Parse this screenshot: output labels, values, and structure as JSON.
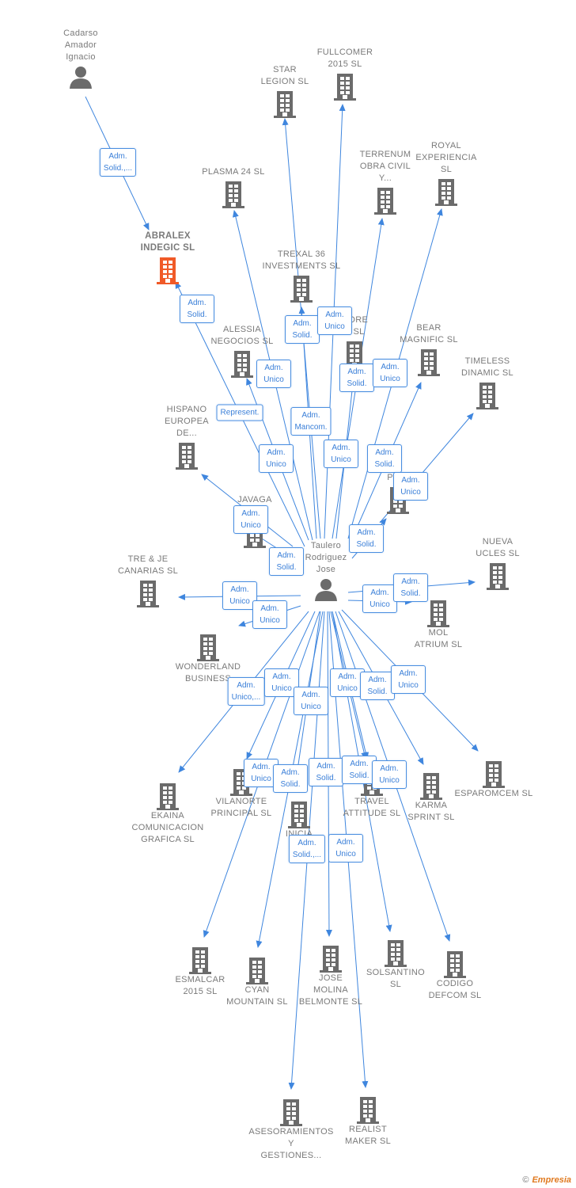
{
  "colors": {
    "edge": "#3f86de",
    "building": "#6b6b6b",
    "highlight": "#f05a28",
    "label": "#7a7a7a"
  },
  "center": {
    "name": "Taulero\nRodriguez\nJose",
    "icon": "person-icon"
  },
  "nodes": [
    {
      "name": "Cadarso\nAmador\nIgnacio",
      "icon": "person-icon"
    },
    {
      "name": "ABRALEX\nINDEGIC  SL",
      "icon": "building-icon",
      "highlight": true
    },
    {
      "name": "STAR\nLEGION  SL",
      "icon": "building-icon"
    },
    {
      "name": "FULLCOMER\n2015  SL",
      "icon": "building-icon"
    },
    {
      "name": "PLASMA 24 SL",
      "icon": "building-icon"
    },
    {
      "name": "TERRENUM\nOBRA CIVIL\nY...",
      "icon": "building-icon"
    },
    {
      "name": "ROYAL\nEXPERIENCIA\nSL",
      "icon": "building-icon"
    },
    {
      "name": "TREXAL 36\nINVESTMENTS SL",
      "icon": "building-icon"
    },
    {
      "name": "ALESSIA\nNEGOCIOS  SL",
      "icon": "building-icon"
    },
    {
      "name": "MORE\nS  SL",
      "icon": "building-icon"
    },
    {
      "name": "BEAR\nMAGNIFIC  SL",
      "icon": "building-icon"
    },
    {
      "name": "TIMELESS\nDINAMIC  SL",
      "icon": "building-icon"
    },
    {
      "name": "HISPANO\nEUROPEA\nDE...",
      "icon": "building-icon"
    },
    {
      "name": "E\nPIGE",
      "icon": "building-icon"
    },
    {
      "name": "JAVAGA\nM     SL",
      "icon": "building-icon"
    },
    {
      "name": "TRE & JE\nCANARIAS  SL",
      "icon": "building-icon"
    },
    {
      "name": "NUEVA\nUCLES  SL",
      "icon": "building-icon"
    },
    {
      "name": "MOL\nATRIUM  SL",
      "icon": "building-icon"
    },
    {
      "name": "WONDERLAND\nBUSINESS",
      "icon": "building-icon"
    },
    {
      "name": "EKAINA\nCOMUNICACION\nGRAFICA  SL",
      "icon": "building-icon"
    },
    {
      "name": "VILANORTE\nPRINCIPAL  SL",
      "icon": "building-icon"
    },
    {
      "name": "INICIA\nSP",
      "icon": "building-icon"
    },
    {
      "name": "TRAVEL\nATTITUDE  SL",
      "icon": "building-icon"
    },
    {
      "name": "KARMA\nSPRINT  SL",
      "icon": "building-icon"
    },
    {
      "name": "ESPAROMCEM SL",
      "icon": "building-icon"
    },
    {
      "name": "ESMALCAR\n2015  SL",
      "icon": "building-icon"
    },
    {
      "name": "CYAN\nMOUNTAIN  SL",
      "icon": "building-icon"
    },
    {
      "name": "JOSE\nMOLINA\nBELMONTE  SL",
      "icon": "building-icon"
    },
    {
      "name": "SOLSANTINO\nSL",
      "icon": "building-icon"
    },
    {
      "name": "CODIGO\nDEFCOM  SL",
      "icon": "building-icon"
    },
    {
      "name": "ASESORAMIENTOS\nY\nGESTIONES...",
      "icon": "building-icon"
    },
    {
      "name": "REALIST\nMAKER  SL",
      "icon": "building-icon"
    }
  ],
  "roles": [
    "Adm.\nSolid.,...",
    "Adm.\nSolid.",
    "Adm.\nSolid.",
    "Adm.\nUnico",
    "Adm.\nUnico",
    "Adm.\nSolid.",
    "Adm.\nUnico",
    "Represent.",
    "Adm.\nMancom.",
    "Adm.\nUnico",
    "Adm.\nUnico",
    "Adm.\nSolid.",
    "Adm.\nUnico",
    "Adm.\nUnico",
    "Adm.\nSolid.",
    "Adm.\nSolid.",
    "Adm.\nUnico",
    "Adm.\nUnico",
    "Adm.\nUnico",
    "Adm.\nSolid.",
    "Adm.\nUnico,...",
    "Adm.\nUnico",
    "Adm.\nUnico",
    "Adm.\nUnico",
    "Adm.\nSolid.",
    "Adm.\nUnico",
    "Adm.\nUnico",
    "Adm.\nSolid.",
    "Adm.\nSolid.",
    "Adm.\nSolid.",
    "Adm.\nUnico",
    "Adm.\nSolid.,...",
    "Adm.\nUnico"
  ],
  "footer": {
    "copyright": "©",
    "brand": "Empresia"
  }
}
